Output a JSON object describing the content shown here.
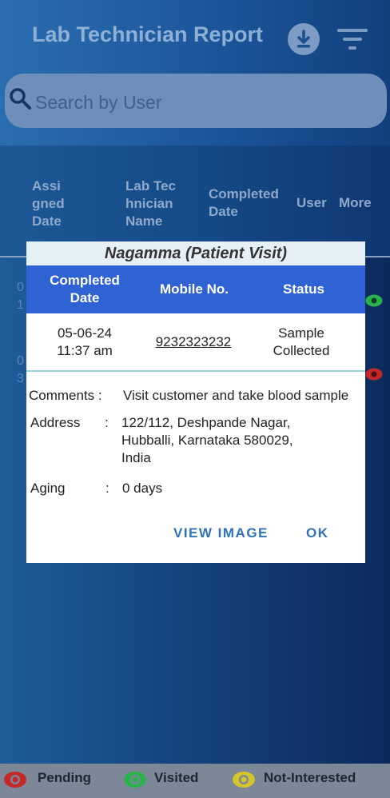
{
  "header": {
    "title": "Lab Technician Report",
    "download_icon": "download-icon",
    "filter_icon": "filter-icon"
  },
  "search": {
    "placeholder": "Search by User",
    "icon": "search-icon"
  },
  "table": {
    "columns": [
      "Assi\ngned\nDate",
      "Lab Tec\nhnician\nName",
      "Completed\nDate",
      "User",
      "More"
    ],
    "rows_partial": [
      {
        "first": "0",
        "second": "1",
        "status_color": "#2bb24c"
      },
      {
        "first": "0",
        "second": "3",
        "status_color": "#c62828"
      }
    ]
  },
  "dialog": {
    "title": "Nagamma (Patient Visit)",
    "columns": [
      "Completed\nDate",
      "Mobile No.",
      "Status"
    ],
    "row": {
      "completed_date": "05-06-24\n11:37 am",
      "mobile": "9232323232",
      "status": "Sample\nCollected"
    },
    "comments_label": "Comments :",
    "comments_value": "Visit customer and take blood sample",
    "address_label": "Address",
    "address_sep": ":",
    "address_value": "122/112, Deshpande Nagar,\nHubballi, Karnataka 580029,\nIndia",
    "aging_label": "Aging",
    "aging_sep": ":",
    "aging_value": "0 days",
    "buttons": {
      "view_image": "VIEW IMAGE",
      "ok": "OK"
    }
  },
  "legend": [
    {
      "label": "Pending",
      "color": "#c62828",
      "icon": "eye-icon"
    },
    {
      "label": "Visited",
      "color": "#2bb24c",
      "icon": "eye-icon"
    },
    {
      "label": "Not-Interested",
      "color": "#d4c52c",
      "icon": "eye-icon"
    }
  ]
}
